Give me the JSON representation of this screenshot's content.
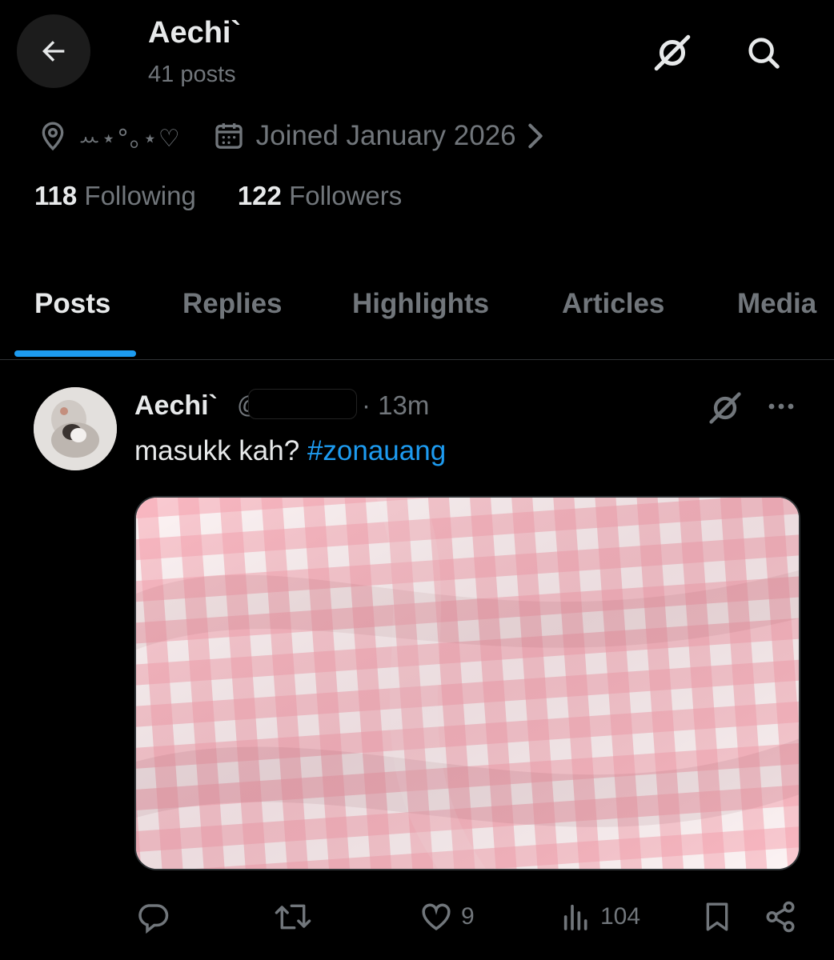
{
  "header": {
    "title": "Aechi`",
    "subtitle": "41 posts",
    "icons": [
      "back-arrow-icon",
      "grok-icon",
      "search-icon"
    ]
  },
  "profile": {
    "location": "ꕀ⋆°｡⋆♡",
    "joined": "Joined January 2026",
    "following_count": "118",
    "following_label": "Following",
    "followers_count": "122",
    "followers_label": "Followers"
  },
  "tabs": [
    "Posts",
    "Replies",
    "Highlights",
    "Articles",
    "Media"
  ],
  "active_tab": "Posts",
  "post": {
    "author": "Aechi`",
    "handle": "@",
    "separator": "·",
    "time": "13m",
    "text": "masukk kah? ",
    "hashtag": "#zonauang",
    "likes": "9",
    "views": "104"
  },
  "colors": {
    "background": "#000000",
    "accent": "#1d9bf0",
    "muted": "#71767b",
    "text": "#e7e9ea",
    "gingham_pink": "#f7a8b4"
  }
}
